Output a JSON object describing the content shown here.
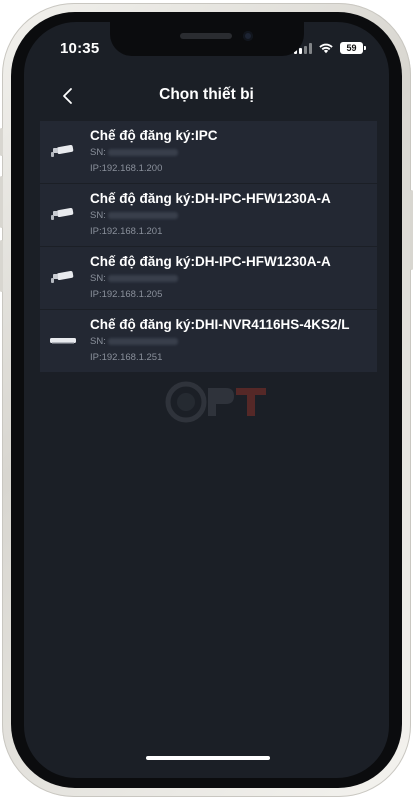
{
  "status_bar": {
    "time": "10:35",
    "battery": "59"
  },
  "nav": {
    "title": "Chọn thiết bị",
    "back_icon": "chevron-left-icon"
  },
  "devices": [
    {
      "model": "Chế độ đăng ký:IPC",
      "sn_label": "SN:",
      "ip": "IP:192.168.1.200",
      "icon": "bullet-camera-icon"
    },
    {
      "model": "Chế độ đăng ký:DH-IPC-HFW1230A-A",
      "sn_label": "SN:",
      "ip": "IP:192.168.1.201",
      "icon": "bullet-camera-icon"
    },
    {
      "model": "Chế độ đăng ký:DH-IPC-HFW1230A-A",
      "sn_label": "SN:",
      "ip": "IP:192.168.1.205",
      "icon": "bullet-camera-icon"
    },
    {
      "model": "Chế độ đăng ký:DHI-NVR4116HS-4KS2/L",
      "sn_label": "SN:",
      "ip": "IP:192.168.1.251",
      "icon": "nvr-recorder-icon"
    }
  ],
  "colors": {
    "background": "#1b1f26",
    "list_item": "#232833",
    "text_primary": "#ffffff",
    "text_secondary": "#8a909b",
    "watermark_accent": "#c0392b"
  }
}
